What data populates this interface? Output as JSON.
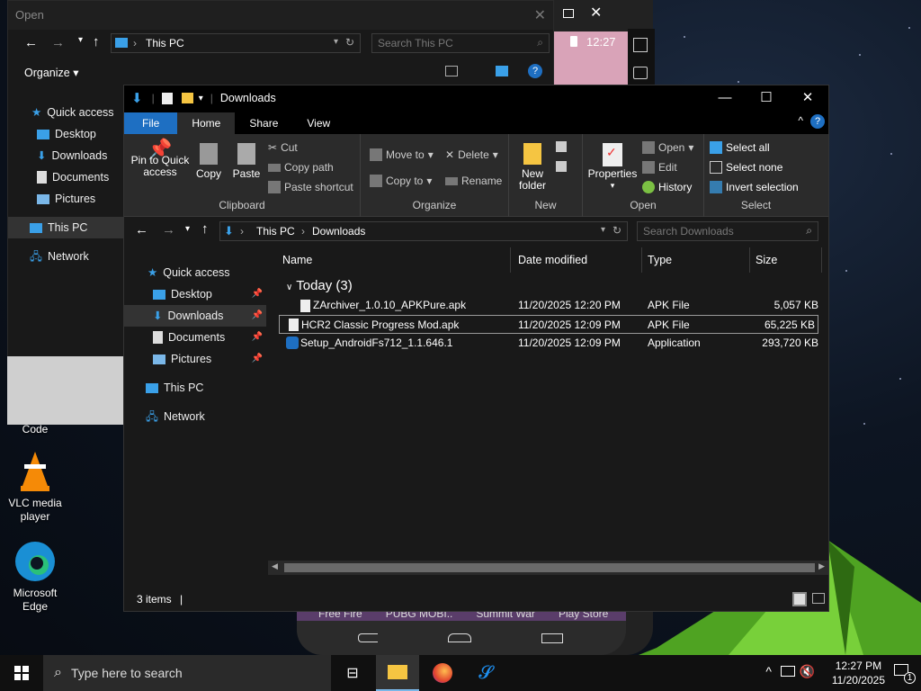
{
  "desktop": {
    "icons": [
      {
        "label": "Code"
      },
      {
        "label": "VLC media player"
      },
      {
        "label": "Microsoft Edge"
      }
    ]
  },
  "phone": {
    "time": "12:27",
    "apps": [
      "Free Fire",
      "PUBG MOBI..",
      "Summit War",
      "Play Store"
    ]
  },
  "back_dialog": {
    "title": "Open",
    "address": "This PC",
    "search_placeholder": "Search This PC",
    "organize": "Organize",
    "nav": [
      "Quick access",
      "Desktop",
      "Downloads",
      "Documents",
      "Pictures",
      "This PC",
      "Network"
    ]
  },
  "explorer": {
    "title": "Downloads",
    "tabs": [
      "File",
      "Home",
      "Share",
      "View"
    ],
    "ribbon": {
      "clipboard": {
        "label": "Clipboard",
        "pin": "Pin to Quick access",
        "copy": "Copy",
        "paste": "Paste",
        "cut": "Cut",
        "copy_path": "Copy path",
        "paste_shortcut": "Paste shortcut"
      },
      "organize": {
        "label": "Organize",
        "move_to": "Move to",
        "copy_to": "Copy to",
        "delete": "Delete",
        "rename": "Rename"
      },
      "new": {
        "label": "New",
        "new_folder": "New folder"
      },
      "open": {
        "label": "Open",
        "properties": "Properties",
        "open": "Open",
        "edit": "Edit",
        "history": "History"
      },
      "select": {
        "label": "Select",
        "select_all": "Select all",
        "select_none": "Select none",
        "invert": "Invert selection"
      }
    },
    "breadcrumb": [
      "This PC",
      "Downloads"
    ],
    "search_placeholder": "Search Downloads",
    "nav": [
      "Quick access",
      "Desktop",
      "Downloads",
      "Documents",
      "Pictures",
      "This PC",
      "Network"
    ],
    "columns": [
      "Name",
      "Date modified",
      "Type",
      "Size"
    ],
    "group": "Today (3)",
    "files": [
      {
        "name": "ZArchiver_1.0.10_APKPure.apk",
        "date": "11/20/2025 12:20 PM",
        "type": "APK File",
        "size": "5,057 KB"
      },
      {
        "name": "HCR2 Classic Progress Mod.apk",
        "date": "11/20/2025 12:09 PM",
        "type": "APK File",
        "size": "65,225 KB"
      },
      {
        "name": "Setup_AndroidFs712_1.1.646.1",
        "date": "11/20/2025 12:09 PM",
        "type": "Application",
        "size": "293,720 KB"
      }
    ],
    "status": "3 items"
  },
  "taskbar": {
    "search_placeholder": "Type here to search",
    "time": "12:27 PM",
    "date": "11/20/2025",
    "notification_count": "1"
  }
}
